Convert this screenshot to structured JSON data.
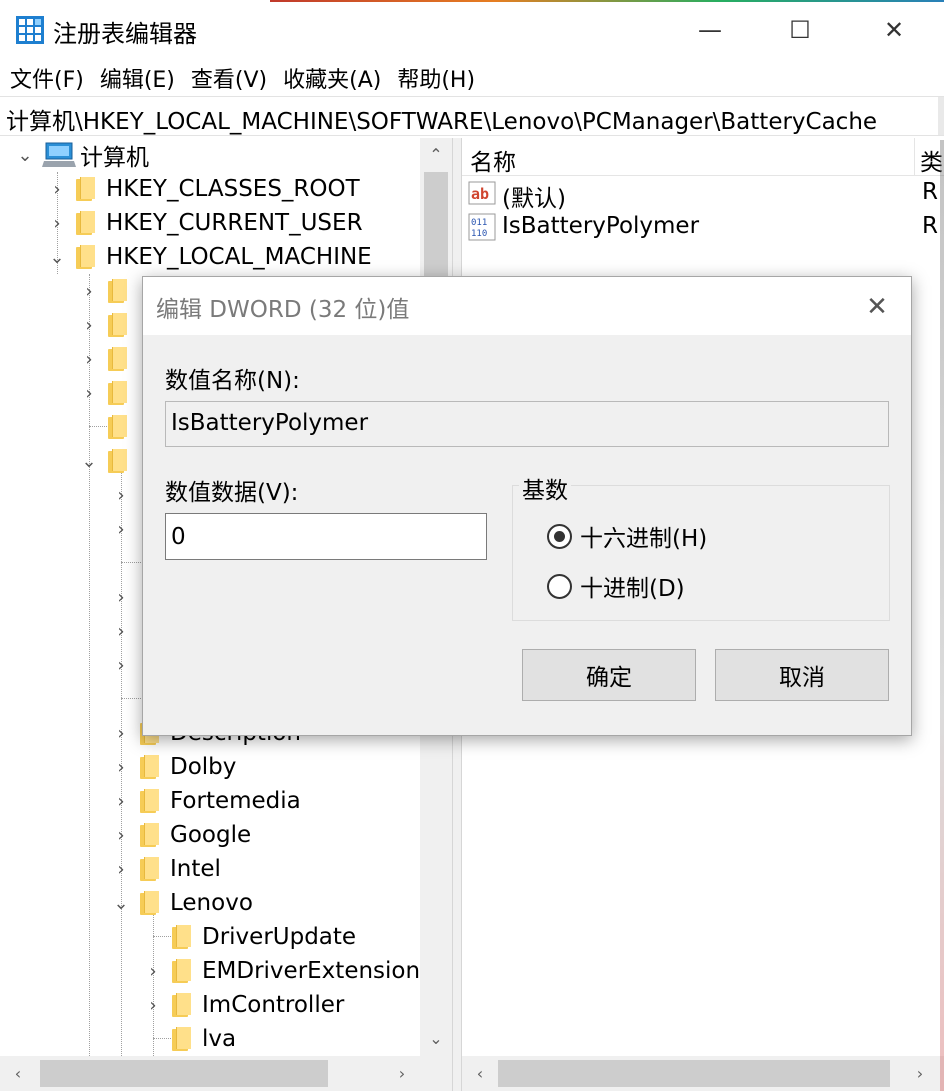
{
  "window": {
    "title": "注册表编辑器",
    "controls": {
      "minimize": "—",
      "maximize": "☐",
      "close": "✕"
    }
  },
  "menubar": {
    "items": [
      "文件(F)",
      "编辑(E)",
      "查看(V)",
      "收藏夹(A)",
      "帮助(H)"
    ]
  },
  "address": "计算机\\HKEY_LOCAL_MACHINE\\SOFTWARE\\Lenovo\\PCManager\\BatteryCache",
  "tree": {
    "root": "计算机",
    "items": [
      {
        "label": "HKEY_CLASSES_ROOT",
        "expanded": false
      },
      {
        "label": "HKEY_CURRENT_USER",
        "expanded": false
      },
      {
        "label": "HKEY_LOCAL_MACHINE",
        "expanded": true
      },
      {
        "label": "Description",
        "expanded": false
      },
      {
        "label": "Dolby",
        "expanded": false
      },
      {
        "label": "Fortemedia",
        "expanded": false
      },
      {
        "label": "Google",
        "expanded": false
      },
      {
        "label": "Intel",
        "expanded": false
      },
      {
        "label": "Lenovo",
        "expanded": true
      },
      {
        "label": "DriverUpdate",
        "expanded": false
      },
      {
        "label": "EMDriverExtension",
        "expanded": false
      },
      {
        "label": "ImController",
        "expanded": false
      },
      {
        "label": "lva",
        "expanded": false
      }
    ]
  },
  "list": {
    "headers": {
      "name": "名称",
      "type": "类"
    },
    "rows": [
      {
        "icon": "string-value-icon",
        "name": "(默认)",
        "type": "R"
      },
      {
        "icon": "binary-value-icon",
        "name": "IsBatteryPolymer",
        "type": "R"
      }
    ]
  },
  "dialog": {
    "title": "编辑 DWORD (32 位)值",
    "value_name_label": "数值名称(N):",
    "value_name": "IsBatteryPolymer",
    "value_data_label": "数值数据(V):",
    "value_data": "0",
    "base_label": "基数",
    "base_options": [
      "十六进制(H)",
      "十进制(D)"
    ],
    "base_selected": "十六进制(H)",
    "ok_label": "确定",
    "cancel_label": "取消"
  },
  "icons": {
    "app": "regedit-icon",
    "computer": "computer-icon",
    "folder": "folder-icon",
    "chevron_right": "›",
    "chevron_down": "⌄",
    "scroll_up": "⌃",
    "scroll_down": "⌄",
    "scroll_left": "‹",
    "scroll_right": "›"
  },
  "colors": {
    "folder": "#f6cc56",
    "computer_icon": "#2b8fd6",
    "string_icon": "#d0452f",
    "binary_icon": "#2a55b0"
  }
}
